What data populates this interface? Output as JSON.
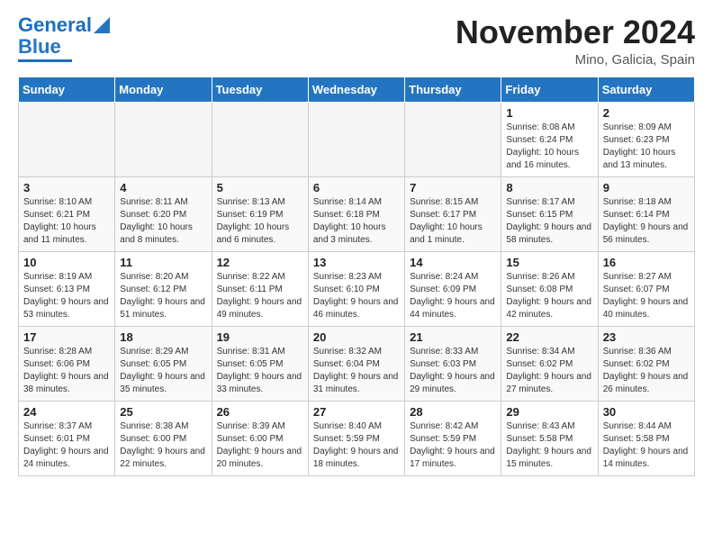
{
  "logo": {
    "line1": "General",
    "line2": "Blue"
  },
  "header": {
    "month": "November 2024",
    "location": "Mino, Galicia, Spain"
  },
  "weekdays": [
    "Sunday",
    "Monday",
    "Tuesday",
    "Wednesday",
    "Thursday",
    "Friday",
    "Saturday"
  ],
  "weeks": [
    [
      {
        "day": "",
        "info": ""
      },
      {
        "day": "",
        "info": ""
      },
      {
        "day": "",
        "info": ""
      },
      {
        "day": "",
        "info": ""
      },
      {
        "day": "",
        "info": ""
      },
      {
        "day": "1",
        "info": "Sunrise: 8:08 AM\nSunset: 6:24 PM\nDaylight: 10 hours and 16 minutes."
      },
      {
        "day": "2",
        "info": "Sunrise: 8:09 AM\nSunset: 6:23 PM\nDaylight: 10 hours and 13 minutes."
      }
    ],
    [
      {
        "day": "3",
        "info": "Sunrise: 8:10 AM\nSunset: 6:21 PM\nDaylight: 10 hours and 11 minutes."
      },
      {
        "day": "4",
        "info": "Sunrise: 8:11 AM\nSunset: 6:20 PM\nDaylight: 10 hours and 8 minutes."
      },
      {
        "day": "5",
        "info": "Sunrise: 8:13 AM\nSunset: 6:19 PM\nDaylight: 10 hours and 6 minutes."
      },
      {
        "day": "6",
        "info": "Sunrise: 8:14 AM\nSunset: 6:18 PM\nDaylight: 10 hours and 3 minutes."
      },
      {
        "day": "7",
        "info": "Sunrise: 8:15 AM\nSunset: 6:17 PM\nDaylight: 10 hours and 1 minute."
      },
      {
        "day": "8",
        "info": "Sunrise: 8:17 AM\nSunset: 6:15 PM\nDaylight: 9 hours and 58 minutes."
      },
      {
        "day": "9",
        "info": "Sunrise: 8:18 AM\nSunset: 6:14 PM\nDaylight: 9 hours and 56 minutes."
      }
    ],
    [
      {
        "day": "10",
        "info": "Sunrise: 8:19 AM\nSunset: 6:13 PM\nDaylight: 9 hours and 53 minutes."
      },
      {
        "day": "11",
        "info": "Sunrise: 8:20 AM\nSunset: 6:12 PM\nDaylight: 9 hours and 51 minutes."
      },
      {
        "day": "12",
        "info": "Sunrise: 8:22 AM\nSunset: 6:11 PM\nDaylight: 9 hours and 49 minutes."
      },
      {
        "day": "13",
        "info": "Sunrise: 8:23 AM\nSunset: 6:10 PM\nDaylight: 9 hours and 46 minutes."
      },
      {
        "day": "14",
        "info": "Sunrise: 8:24 AM\nSunset: 6:09 PM\nDaylight: 9 hours and 44 minutes."
      },
      {
        "day": "15",
        "info": "Sunrise: 8:26 AM\nSunset: 6:08 PM\nDaylight: 9 hours and 42 minutes."
      },
      {
        "day": "16",
        "info": "Sunrise: 8:27 AM\nSunset: 6:07 PM\nDaylight: 9 hours and 40 minutes."
      }
    ],
    [
      {
        "day": "17",
        "info": "Sunrise: 8:28 AM\nSunset: 6:06 PM\nDaylight: 9 hours and 38 minutes."
      },
      {
        "day": "18",
        "info": "Sunrise: 8:29 AM\nSunset: 6:05 PM\nDaylight: 9 hours and 35 minutes."
      },
      {
        "day": "19",
        "info": "Sunrise: 8:31 AM\nSunset: 6:05 PM\nDaylight: 9 hours and 33 minutes."
      },
      {
        "day": "20",
        "info": "Sunrise: 8:32 AM\nSunset: 6:04 PM\nDaylight: 9 hours and 31 minutes."
      },
      {
        "day": "21",
        "info": "Sunrise: 8:33 AM\nSunset: 6:03 PM\nDaylight: 9 hours and 29 minutes."
      },
      {
        "day": "22",
        "info": "Sunrise: 8:34 AM\nSunset: 6:02 PM\nDaylight: 9 hours and 27 minutes."
      },
      {
        "day": "23",
        "info": "Sunrise: 8:36 AM\nSunset: 6:02 PM\nDaylight: 9 hours and 26 minutes."
      }
    ],
    [
      {
        "day": "24",
        "info": "Sunrise: 8:37 AM\nSunset: 6:01 PM\nDaylight: 9 hours and 24 minutes."
      },
      {
        "day": "25",
        "info": "Sunrise: 8:38 AM\nSunset: 6:00 PM\nDaylight: 9 hours and 22 minutes."
      },
      {
        "day": "26",
        "info": "Sunrise: 8:39 AM\nSunset: 6:00 PM\nDaylight: 9 hours and 20 minutes."
      },
      {
        "day": "27",
        "info": "Sunrise: 8:40 AM\nSunset: 5:59 PM\nDaylight: 9 hours and 18 minutes."
      },
      {
        "day": "28",
        "info": "Sunrise: 8:42 AM\nSunset: 5:59 PM\nDaylight: 9 hours and 17 minutes."
      },
      {
        "day": "29",
        "info": "Sunrise: 8:43 AM\nSunset: 5:58 PM\nDaylight: 9 hours and 15 minutes."
      },
      {
        "day": "30",
        "info": "Sunrise: 8:44 AM\nSunset: 5:58 PM\nDaylight: 9 hours and 14 minutes."
      }
    ]
  ]
}
